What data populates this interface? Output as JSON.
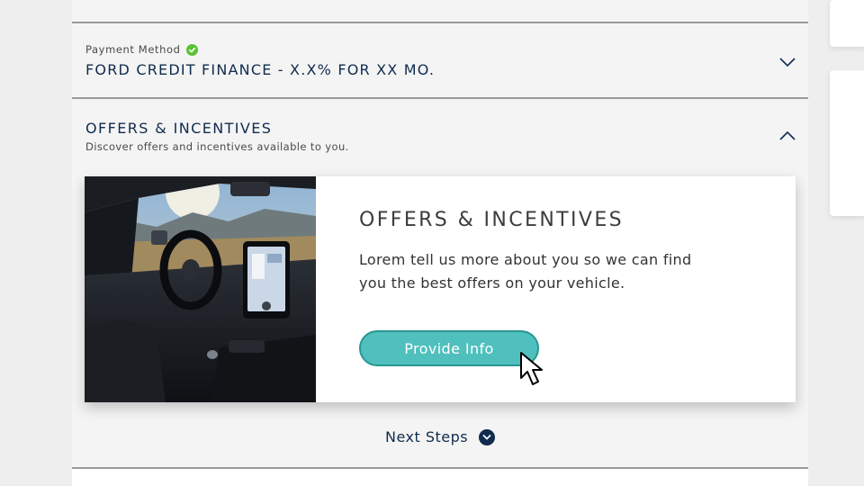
{
  "payment": {
    "label": "Payment Method",
    "value": "FORD CREDIT FINANCE - X.X% FOR XX MO.",
    "status": "complete"
  },
  "offers_section": {
    "title": "OFFERS & INCENTIVES",
    "subtitle": "Discover offers and incentives available to you.",
    "expanded": true
  },
  "offer_card": {
    "title": "OFFERS & INCENTIVES",
    "text": "Lorem tell us more about you so we can find you the best offers on your vehicle.",
    "button_label": "Provide Info",
    "image_alt": "vehicle-interior-photo"
  },
  "next_steps": {
    "label": "Next Steps"
  },
  "colors": {
    "navy": "#102b4e",
    "teal_button": "#4fc0bd",
    "check_green": "#5bc236",
    "divider": "#9a9a9a"
  },
  "icons": {
    "status": "check-circle-icon",
    "collapsed": "chevron-down-icon",
    "expanded": "chevron-up-icon",
    "next_steps": "chevron-down-circle-icon",
    "pointer": "mouse-cursor-icon"
  }
}
